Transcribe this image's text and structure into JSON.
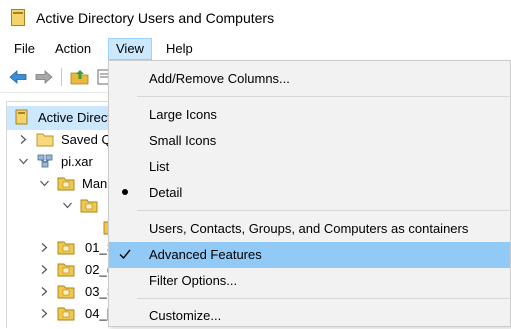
{
  "window": {
    "title": "Active Directory Users and Computers"
  },
  "menubar": {
    "items": [
      "File",
      "Action",
      "View",
      "Help"
    ],
    "active": "View"
  },
  "tree": {
    "items": [
      {
        "label": "Active Directo",
        "icon": "ad-root-icon"
      },
      {
        "label": "Saved Q",
        "icon": "folder-icon"
      },
      {
        "label": "pi.xar",
        "icon": "domain-icon"
      },
      {
        "label": "Man",
        "icon": "ou-folder-icon"
      },
      {
        "label": "",
        "icon": "ou-folder-icon"
      },
      {
        "label": "",
        "icon": "ou-folder-icon"
      },
      {
        "label": "01_S",
        "icon": "ou-folder-icon"
      },
      {
        "label": "02_(",
        "icon": "ou-folder-icon"
      },
      {
        "label": "03_S",
        "icon": "ou-folder-icon"
      },
      {
        "label": "04_[",
        "icon": "ou-folder-icon"
      }
    ]
  },
  "view_menu": {
    "items": [
      {
        "label": "Add/Remove Columns...",
        "mark": ""
      },
      {
        "label": "Large Icons",
        "mark": ""
      },
      {
        "label": "Small Icons",
        "mark": ""
      },
      {
        "label": "List",
        "mark": ""
      },
      {
        "label": "Detail",
        "mark": "bullet"
      },
      {
        "label": "Users, Contacts, Groups, and Computers as containers",
        "mark": ""
      },
      {
        "label": "Advanced Features",
        "mark": "check",
        "highlighted": true
      },
      {
        "label": "Filter Options...",
        "mark": ""
      },
      {
        "label": "Customize...",
        "mark": ""
      }
    ]
  },
  "colors": {
    "menu_active_bg": "#cce8ff",
    "menu_highlight_bg": "#91c9f7",
    "menu_bg": "#f2f2f2",
    "folder": "#e8b93c"
  }
}
